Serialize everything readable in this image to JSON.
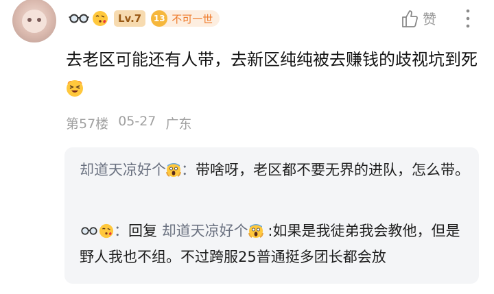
{
  "user": {
    "level_badge": "Lv.7",
    "fan_level": "13",
    "fan_title": "不可一世"
  },
  "actions": {
    "like_label": "赞"
  },
  "post": {
    "text": "去老区可能还有人带，去新区纯纯被去赚钱的歧视坑到死",
    "floor": "第57楼",
    "date": "05-27",
    "location": "广东"
  },
  "replies": [
    {
      "author": "却道天凉好个",
      "colon": "：",
      "text": "带啥呀，老区都不要无界的进队，怎么带。"
    },
    {
      "colon": "：",
      "reply_prefix": "回复",
      "reply_to": "却道天凉好个",
      "text": ":如果是我徒弟我会教他，但是野人我也不组。不过跨服25普通挺多团长都会放"
    }
  ],
  "icons": {
    "glasses": "glasses-emoji-icon",
    "kiss": "kissing-face-icon",
    "scream": "screaming-face-icon",
    "dizzy": "dizzy-laughing-face-icon",
    "like": "thumbs-up-icon",
    "more": "vertical-dots-icon"
  },
  "colors": {
    "level_bg": "#f7dbb0",
    "fan_accent": "#f6b73c",
    "reply_bg": "#f4f5f7"
  }
}
